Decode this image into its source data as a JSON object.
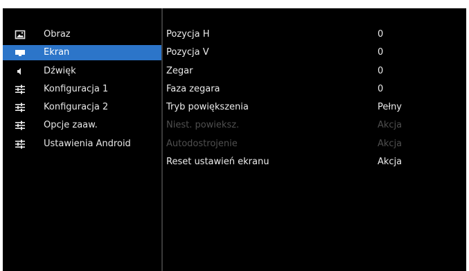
{
  "sidebar": {
    "items": [
      {
        "label": "Obraz",
        "icon": "picture-icon",
        "selected": false
      },
      {
        "label": "Ekran",
        "icon": "screen-icon",
        "selected": true
      },
      {
        "label": "Dźwięk",
        "icon": "speaker-icon",
        "selected": false
      },
      {
        "label": "Konfiguracja 1",
        "icon": "sliders-icon",
        "selected": false
      },
      {
        "label": "Konfiguracja 2",
        "icon": "sliders-icon",
        "selected": false
      },
      {
        "label": "Opcje zaaw.",
        "icon": "sliders-icon",
        "selected": false
      },
      {
        "label": "Ustawienia Android",
        "icon": "sliders-icon",
        "selected": false
      }
    ]
  },
  "settings": {
    "rows": [
      {
        "label": "Pozycja H",
        "value": "0",
        "enabled": true
      },
      {
        "label": "Pozycja V",
        "value": "0",
        "enabled": true
      },
      {
        "label": "Zegar",
        "value": "0",
        "enabled": true
      },
      {
        "label": "Faza zegara",
        "value": "0",
        "enabled": true
      },
      {
        "label": "Tryb powiększenia",
        "value": "Pełny",
        "enabled": true
      },
      {
        "label": "Niest. powieksz.",
        "value": "Akcja",
        "enabled": false
      },
      {
        "label": "Autodostrojenie",
        "value": "Akcja",
        "enabled": false
      },
      {
        "label": "Reset ustawień ekranu",
        "value": "Akcja",
        "enabled": true
      }
    ]
  },
  "colors": {
    "background": "#000000",
    "selected": "#2c75c9",
    "text": "#e8e8e8",
    "disabled_text": "#4f4f4f"
  }
}
